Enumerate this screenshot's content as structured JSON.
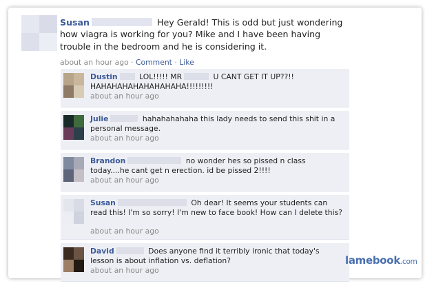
{
  "post": {
    "author": "Susan",
    "text": "Hey Gerald! This is odd but just wondering how viagra is working for you? Mike and I have been having trouble in the bedroom and he is considering it.",
    "time": "about an hour ago",
    "separator1": " · ",
    "comment_link": "Comment",
    "separator2": " · ",
    "like_link": "Like"
  },
  "comments": [
    {
      "author": "Dustin",
      "text_a": "LOL!!!!! MR",
      "text_b": "U CANT GET IT UP??!! HAHAHAHAHAHAHAHAHA!!!!!!!!!",
      "time": "about an hour ago",
      "avatar_colors": [
        "#b7a48a",
        "#c9b79c",
        "#8e7a66",
        "#d8cbb6"
      ]
    },
    {
      "author": "Julie",
      "text": "hahahahahaha this lady needs to send this shit in a personal message.",
      "time": "about an hour ago",
      "avatar_colors": [
        "#1a2a2a",
        "#3f6a3e",
        "#6a3a5a",
        "#2c3f4a"
      ]
    },
    {
      "author": "Brandon",
      "text": "no wonder hes so pissed n class today....he cant get n erection. id be pissed 2!!!!",
      "time": "about an hour ago",
      "avatar_colors": [
        "#7f8aa0",
        "#a7a9b6",
        "#5c6579",
        "#c4c0c6"
      ]
    },
    {
      "author": "Susan",
      "text": "Oh dear! It seems your students can read this! I'm so sorry! I'm new to face book! How can I delete this?",
      "time": "about an hour ago",
      "avatar_colors": [
        "#e4e6ee",
        "#d8dbe6",
        "#eceef4",
        "#cfd3de"
      ]
    },
    {
      "author": "David",
      "text": "Does anyone find it terribly ironic that today's lesson is about inflation vs. deflation?",
      "time": "about an hour ago",
      "avatar_colors": [
        "#3a2a20",
        "#6b5444",
        "#9c7f66",
        "#231a14"
      ]
    }
  ],
  "watermark": {
    "brand": "lamebook",
    "tld": ".com"
  },
  "colors": {
    "link": "#3b5998",
    "comment_bg": "#edeff4",
    "meta": "#888888"
  }
}
